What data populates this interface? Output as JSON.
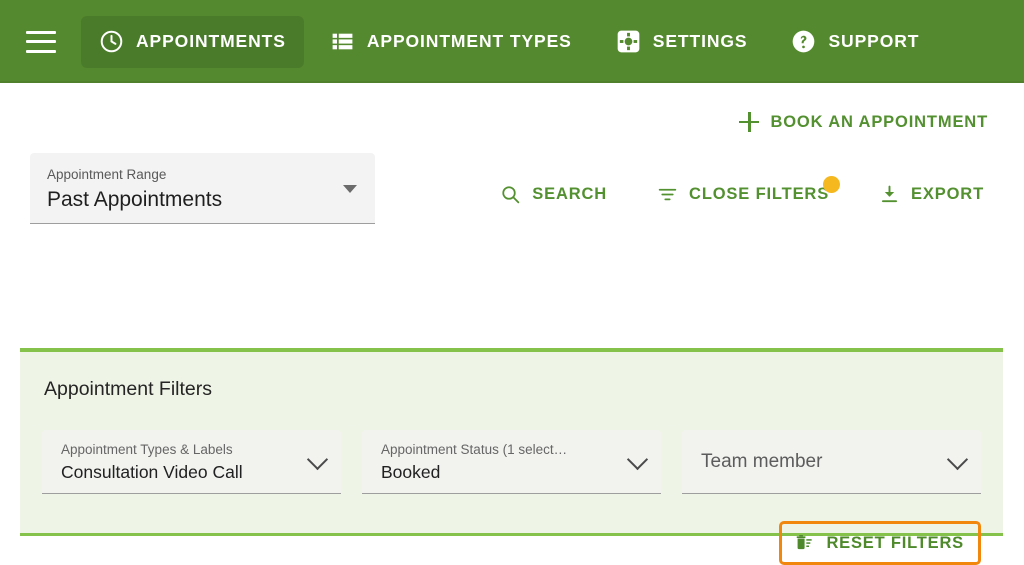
{
  "nav": {
    "menu_icon": "hamburger-menu-icon",
    "items": [
      {
        "label": "APPOINTMENTS",
        "icon": "clock-icon",
        "active": true
      },
      {
        "label": "APPOINTMENT TYPES",
        "icon": "list-icon",
        "active": false
      },
      {
        "label": "SETTINGS",
        "icon": "gear-icon",
        "active": false
      },
      {
        "label": "SUPPORT",
        "icon": "help-circle-icon",
        "active": false
      }
    ]
  },
  "toolbar": {
    "book_appointment_label": "BOOK AN APPOINTMENT",
    "book_appointment_icon": "plus-icon",
    "range_select": {
      "label": "Appointment Range",
      "value": "Past Appointments"
    },
    "actions": [
      {
        "label": "SEARCH",
        "icon": "search-icon",
        "badge": false
      },
      {
        "label": "CLOSE FILTERS",
        "icon": "filter-list-icon",
        "badge": true
      },
      {
        "label": "EXPORT",
        "icon": "download-icon",
        "badge": false
      }
    ]
  },
  "filter_panel": {
    "title": "Appointment Filters",
    "filters": [
      {
        "label": "Appointment Types & Labels",
        "value": "Consultation Video Call",
        "placeholder": "",
        "is_placeholder": false
      },
      {
        "label": "Appointment Status (1 select…",
        "value": "Booked",
        "placeholder": "",
        "is_placeholder": false
      },
      {
        "label": "",
        "value": "Team member",
        "placeholder": "Team member",
        "is_placeholder": true
      }
    ],
    "reset_label": "RESET FILTERS",
    "reset_icon": "delete-sweep-icon"
  },
  "colors": {
    "header_green": "#55892f",
    "active_tab_green": "#4a7b2a",
    "link_green": "#539030",
    "panel_bg": "#eef4e6",
    "panel_border_green": "#85c24b",
    "badge_amber": "#f5b81f",
    "highlight_orange": "#f2870d"
  }
}
